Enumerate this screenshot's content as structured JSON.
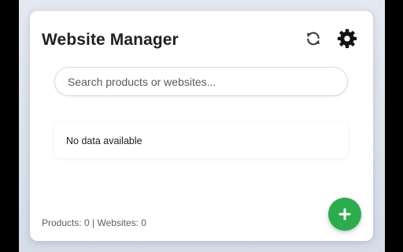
{
  "header": {
    "title": "Website Manager",
    "refresh_icon": "refresh-icon",
    "settings_icon": "gear-icon"
  },
  "search": {
    "placeholder": "Search products or websites...",
    "value": ""
  },
  "list": {
    "empty_message": "No data available"
  },
  "footer": {
    "status": "Products: 0 | Websites: 0"
  },
  "fab": {
    "icon": "plus-icon",
    "color": "#2dab4f"
  },
  "colors": {
    "accent_green": "#2dab4f",
    "background": "#dfe5ee",
    "panel": "#ffffff",
    "title_text": "#1f2125"
  }
}
